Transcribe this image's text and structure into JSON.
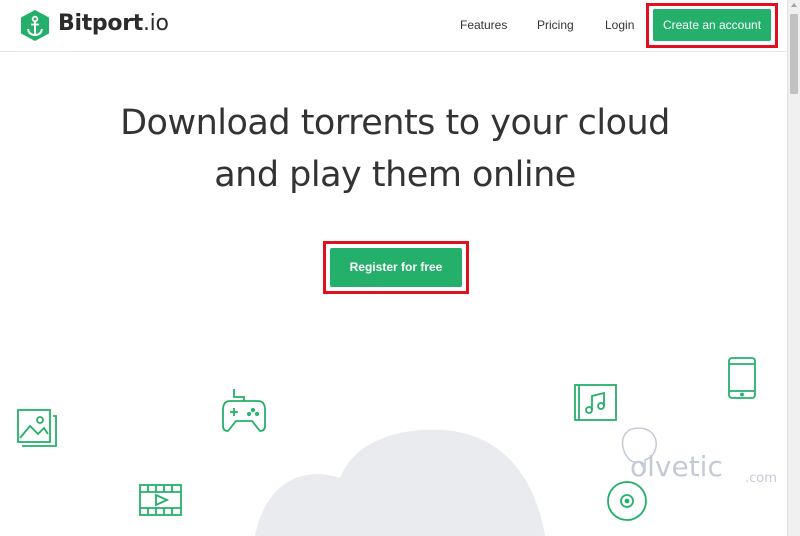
{
  "header": {
    "brand_main": "Bitport",
    "brand_suffix": ".io",
    "nav": {
      "features": "Features",
      "pricing": "Pricing",
      "login": "Login"
    },
    "create_account_label": "Create an account"
  },
  "hero": {
    "title_line1": "Download torrents to your cloud",
    "title_line2": "and play them online",
    "register_label": "Register for free"
  },
  "watermark": {
    "main": "olvetic",
    "suffix": ".com"
  },
  "colors": {
    "accent": "#24b06b",
    "highlight": "#e0101f",
    "cloud": "#e9ebee",
    "text": "#333333"
  },
  "icons": [
    "anchor-logo-icon",
    "image-icon",
    "gamepad-icon",
    "video-icon",
    "music-album-icon",
    "phone-icon",
    "disc-icon",
    "cloud-shape"
  ]
}
